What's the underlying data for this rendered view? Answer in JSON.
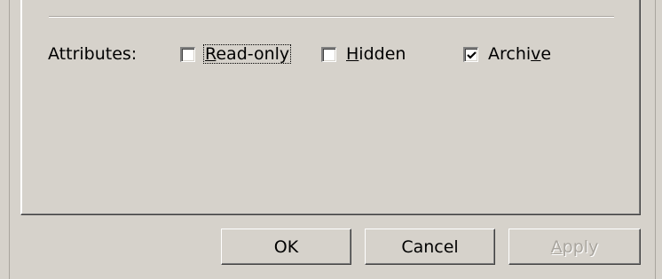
{
  "attributes": {
    "label": "Attributes:",
    "read_only": {
      "label": "Read-only",
      "checked": false
    },
    "hidden": {
      "label": "Hidden",
      "checked": false
    },
    "archive": {
      "label": "Archive",
      "checked": true
    }
  },
  "buttons": {
    "ok": "OK",
    "cancel": "Cancel",
    "apply": "Apply"
  }
}
